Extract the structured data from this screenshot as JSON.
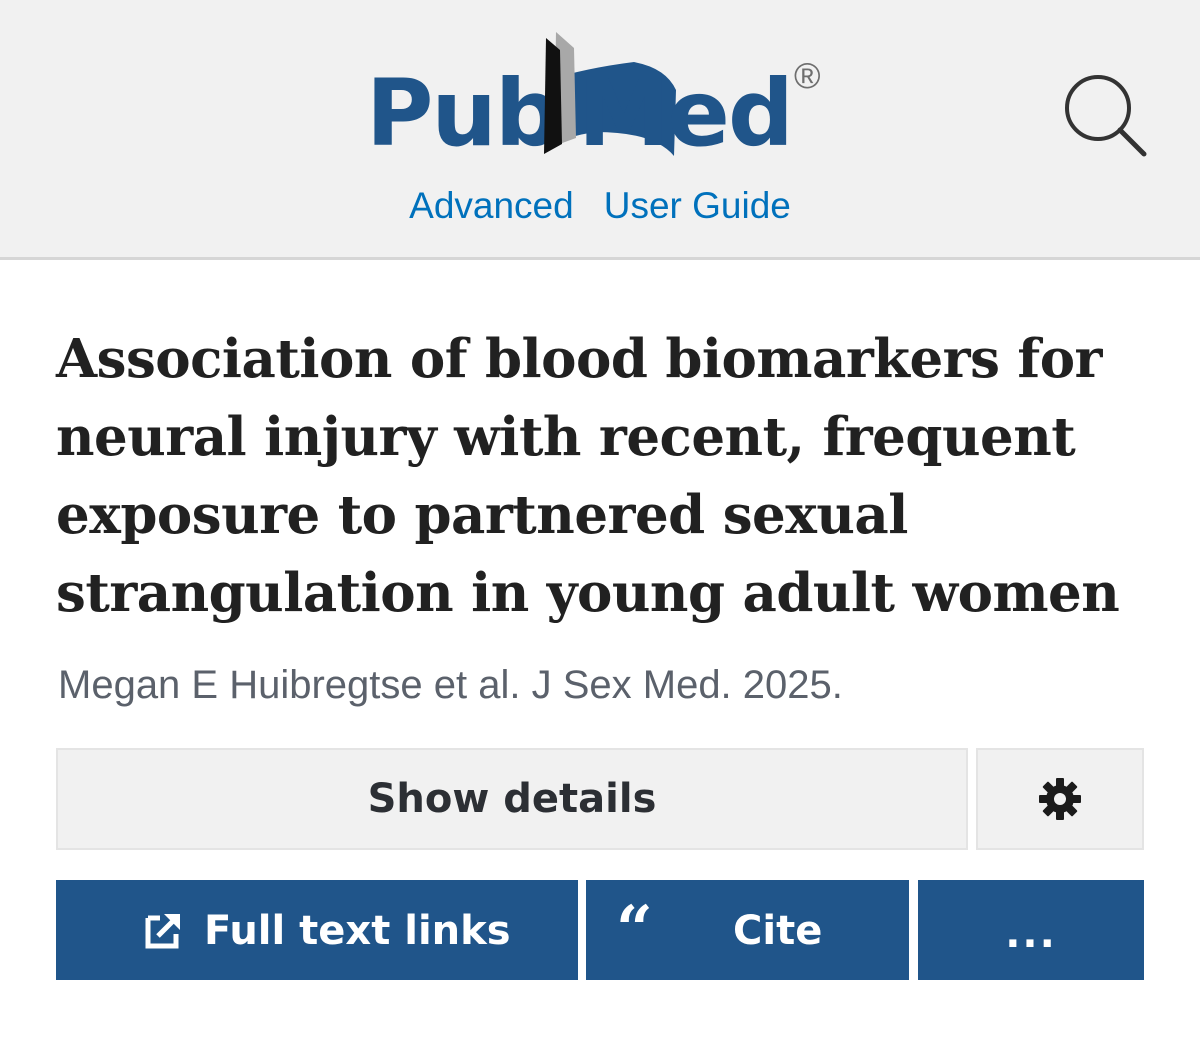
{
  "header": {
    "logo": {
      "part1": "Pub",
      "part2": "Med",
      "registered": "®"
    },
    "links": [
      "Advanced",
      "User Guide"
    ],
    "search_icon": "search-icon"
  },
  "article": {
    "title": "Association of blood biomarkers for neural injury with recent, frequent exposure to partnered sexual strangulation in young adult women",
    "citation": "Megan E Huibregtse et al. J Sex Med. 2025."
  },
  "actions": {
    "show_details": "Show details",
    "settings_icon": "gear-icon",
    "full_text_links": "Full text links",
    "cite": "Cite",
    "cite_icon_glyph": "“",
    "more": "..."
  },
  "colors": {
    "brand_blue": "#20558a",
    "link_blue": "#0071bc",
    "header_bg": "#f1f1f1",
    "title_text": "#212121",
    "citation_text": "#5b616b"
  }
}
